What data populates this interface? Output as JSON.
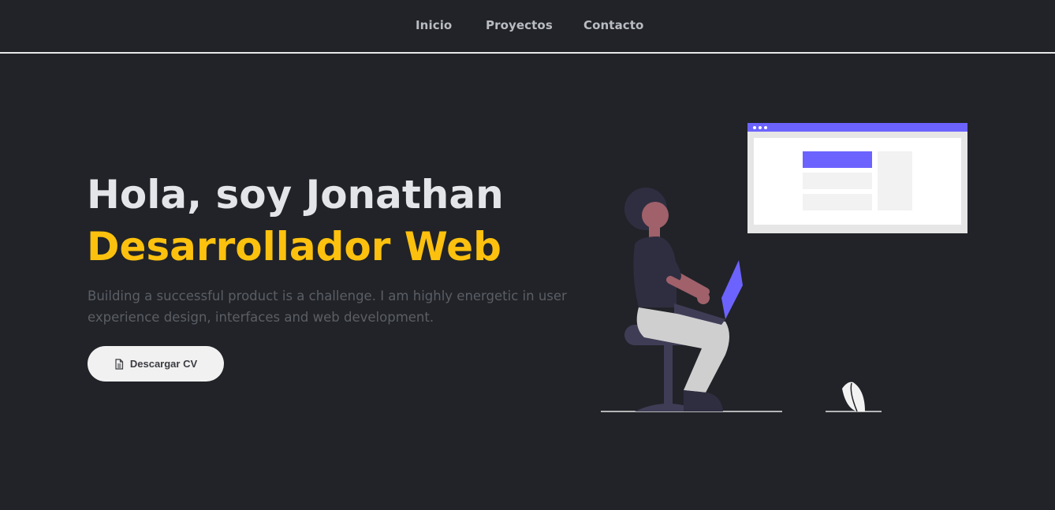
{
  "nav": {
    "items": [
      {
        "label": "Inicio"
      },
      {
        "label": "Proyectos"
      },
      {
        "label": "Contacto"
      }
    ]
  },
  "hero": {
    "greeting": "Hola, soy Jonathan",
    "role": "Desarrollador Web",
    "description": "Building a successful product is a challenge. I am highly energetic in user experience design, interfaces and web development.",
    "cta_label": "Descargar CV",
    "cta_icon": "file-document-icon"
  },
  "colors": {
    "background": "#212328",
    "heading": "#e4e5e8",
    "accent": "#fcc10e",
    "muted_text": "#5b5e65",
    "illustration_accent": "#6c63ff",
    "button_bg": "#f1f1f1"
  }
}
